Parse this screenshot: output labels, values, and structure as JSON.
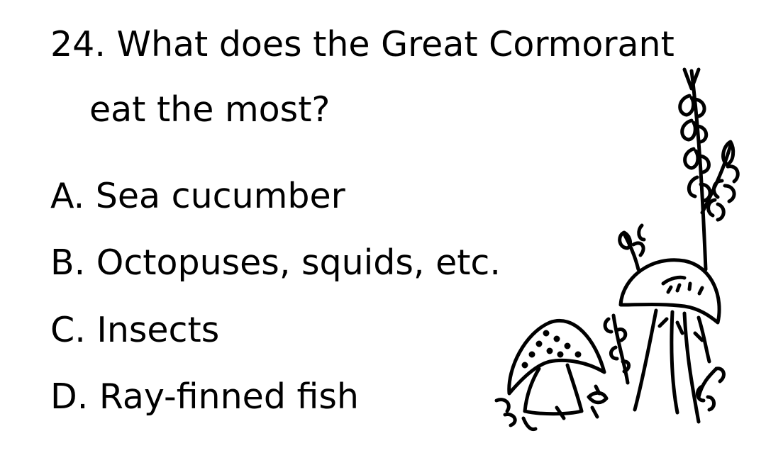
{
  "question": {
    "line1": "24. What does the Great Cormorant",
    "line2": "eat the most?"
  },
  "options": [
    "A. Sea cucumber",
    "B. Octopuses, squids, etc.",
    "C. Insects",
    "D. Ray-finned fish"
  ],
  "illustration": {
    "icon": "mushrooms-and-sprigs-icon",
    "stroke_color": "#000000"
  }
}
